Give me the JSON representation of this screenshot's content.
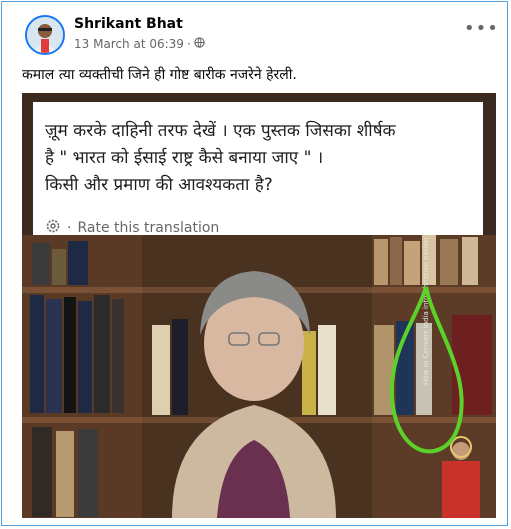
{
  "post": {
    "author": "Shrikant Bhat",
    "timestamp": "13 March at 06:39",
    "separator": "·",
    "caption": "कमाल त्या व्यक्तीची जिने ही गोष्ट बारीक नजरेने हेरली."
  },
  "embedded": {
    "line1": "ज़ूम करके दाहिनी तरफ देखें । एक पुस्तक जिसका शीर्षक",
    "line2": "है \" भारत को ईसाई राष्ट्र कैसे बनाया जाए \" ।",
    "line3": "किसी और प्रमाण की आवश्यकता है?",
    "translate": "Rate this translation",
    "book_spine": "How to Convert India into Christian nation"
  },
  "icons": {
    "privacy": "globe-icon",
    "more": "more-options-icon",
    "translate": "gear-icon"
  },
  "colors": {
    "accent": "#1877f2",
    "highlight": "#5cd12a"
  }
}
